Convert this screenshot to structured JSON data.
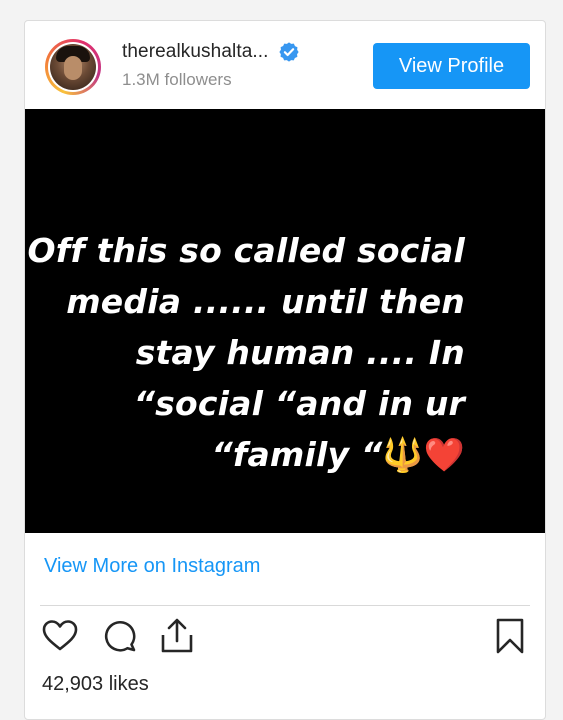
{
  "profile": {
    "username": "therealkushalta...",
    "followers": "1.3M followers",
    "view_profile_label": "View Profile"
  },
  "post": {
    "lines": [
      "Off this so called social",
      "media ...... until then",
      "stay human .... In",
      "“social “and in ur",
      "“family “"
    ],
    "trident_emoji": "🔱",
    "heart_emoji": "❤️"
  },
  "links": {
    "view_more": "View More on Instagram"
  },
  "stats": {
    "likes": "42,903 likes"
  },
  "icons": [
    "heart-icon",
    "comment-icon",
    "share-icon",
    "bookmark-icon",
    "verified-badge-icon"
  ],
  "colors": {
    "accent": "#1696f6",
    "post_background": "#000000"
  }
}
